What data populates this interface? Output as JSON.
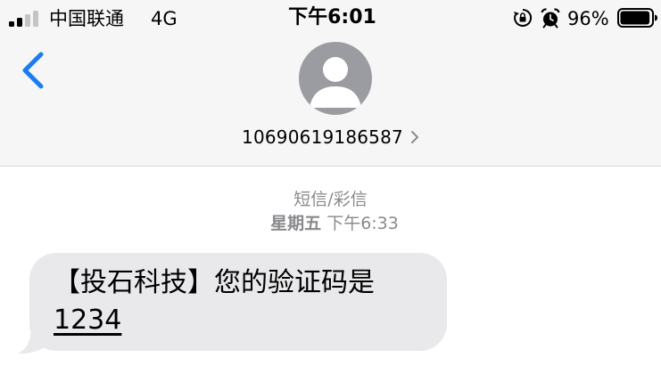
{
  "status_bar": {
    "carrier": "中国联通",
    "network": "4G",
    "time": "下午6:01",
    "battery_percent": "96%",
    "battery_level": 0.96,
    "signal_bars_filled": 2,
    "signal_bars_total": 4
  },
  "header": {
    "back_icon": "chevron-left-icon",
    "avatar_icon": "person-icon",
    "contact_number": "10690619186587",
    "contact_chevron_icon": "chevron-right-icon"
  },
  "conversation": {
    "service_label": "短信/彩信",
    "timestamp_day": "星期五",
    "timestamp_time": "下午6:33",
    "messages": [
      {
        "text": "【投石科技】您的验证码是",
        "code": "1234",
        "direction": "incoming"
      }
    ]
  },
  "colors": {
    "accent": "#1a7cf5",
    "header_bg": "#f6f6f6",
    "bubble_bg": "#e9e9eb",
    "secondary_text": "#8a8a8e",
    "avatar_bg": "#9b9ca1"
  }
}
